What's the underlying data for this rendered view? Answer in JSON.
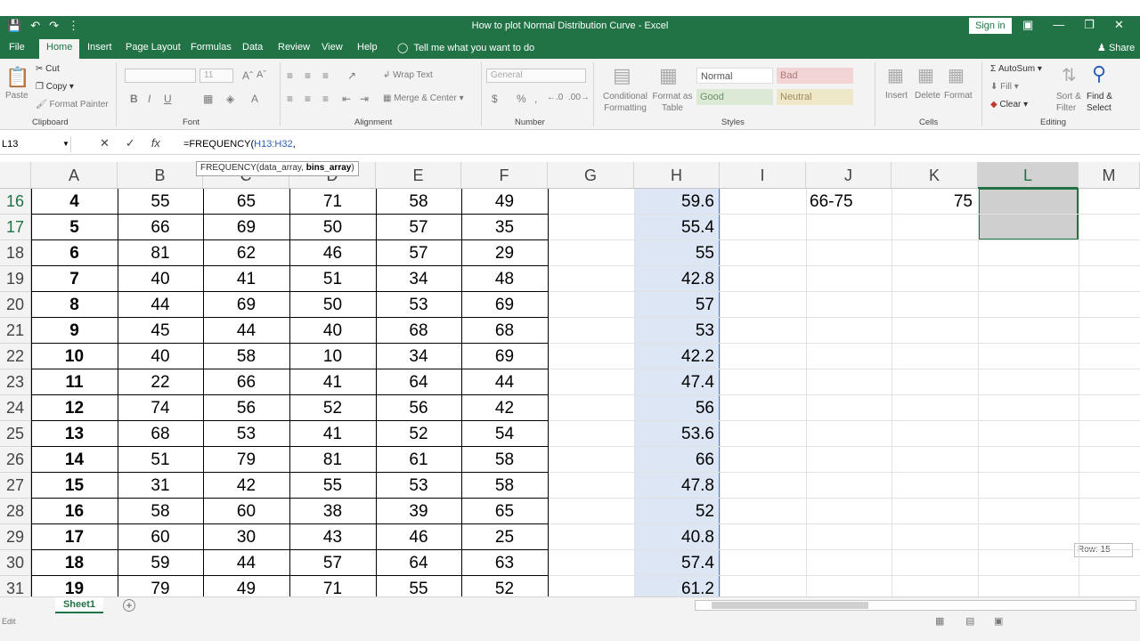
{
  "window": {
    "title": "How to plot Normal Distribution Curve  -  Excel",
    "signin": "Sign in",
    "share": "Share"
  },
  "tabs": [
    "File",
    "Home",
    "Insert",
    "Page Layout",
    "Formulas",
    "Data",
    "Review",
    "View",
    "Help"
  ],
  "tellme": "Tell me what you want to do",
  "ribbon": {
    "clipboard": {
      "paste": "Paste",
      "cut": "Cut",
      "copy": "Copy",
      "format_painter": "Format Painter",
      "label": "Clipboard"
    },
    "font": {
      "size": "11",
      "label": "Font"
    },
    "alignment": {
      "wrap": "Wrap Text",
      "merge": "Merge & Center",
      "label": "Alignment"
    },
    "number": {
      "format": "General",
      "label": "Number"
    },
    "styles": {
      "conditional": "Conditional Formatting",
      "format_as": "Format as Table",
      "normal": "Normal",
      "bad": "Bad",
      "good": "Good",
      "neutral": "Neutral",
      "label": "Styles"
    },
    "cells": {
      "insert": "Insert",
      "delete": "Delete",
      "format": "Format",
      "label": "Cells"
    },
    "editing": {
      "autosum": "AutoSum",
      "fill": "Fill",
      "clear": "Clear",
      "sort": "Sort & Filter",
      "find": "Find & Select",
      "label": "Editing"
    }
  },
  "formula_bar": {
    "namebox": "L13",
    "formula_prefix": "=FREQUENCY(",
    "formula_ref": "H13:H32",
    "formula_suffix": ",",
    "tooltip_prefix": "FREQUENCY(data_array, ",
    "tooltip_bold": "bins_array",
    "tooltip_suffix": ")"
  },
  "columns": [
    "A",
    "B",
    "C",
    "D",
    "E",
    "F",
    "G",
    "H",
    "I",
    "J",
    "K",
    "L",
    "M"
  ],
  "rows": [
    {
      "n": "16",
      "a": "4",
      "b": "55",
      "c": "65",
      "d": "71",
      "e": "58",
      "f": "49",
      "h": "59.6",
      "j": "66-75",
      "k": "75"
    },
    {
      "n": "17",
      "a": "5",
      "b": "66",
      "c": "69",
      "d": "50",
      "e": "57",
      "f": "35",
      "h": "55.4"
    },
    {
      "n": "18",
      "a": "6",
      "b": "81",
      "c": "62",
      "d": "46",
      "e": "57",
      "f": "29",
      "h": "55"
    },
    {
      "n": "19",
      "a": "7",
      "b": "40",
      "c": "41",
      "d": "51",
      "e": "34",
      "f": "48",
      "h": "42.8"
    },
    {
      "n": "20",
      "a": "8",
      "b": "44",
      "c": "69",
      "d": "50",
      "e": "53",
      "f": "69",
      "h": "57"
    },
    {
      "n": "21",
      "a": "9",
      "b": "45",
      "c": "44",
      "d": "40",
      "e": "68",
      "f": "68",
      "h": "53"
    },
    {
      "n": "22",
      "a": "10",
      "b": "40",
      "c": "58",
      "d": "10",
      "e": "34",
      "f": "69",
      "h": "42.2"
    },
    {
      "n": "23",
      "a": "11",
      "b": "22",
      "c": "66",
      "d": "41",
      "e": "64",
      "f": "44",
      "h": "47.4"
    },
    {
      "n": "24",
      "a": "12",
      "b": "74",
      "c": "56",
      "d": "52",
      "e": "56",
      "f": "42",
      "h": "56"
    },
    {
      "n": "25",
      "a": "13",
      "b": "68",
      "c": "53",
      "d": "41",
      "e": "52",
      "f": "54",
      "h": "53.6"
    },
    {
      "n": "26",
      "a": "14",
      "b": "51",
      "c": "79",
      "d": "81",
      "e": "61",
      "f": "58",
      "h": "66"
    },
    {
      "n": "27",
      "a": "15",
      "b": "31",
      "c": "42",
      "d": "55",
      "e": "53",
      "f": "58",
      "h": "47.8"
    },
    {
      "n": "28",
      "a": "16",
      "b": "58",
      "c": "60",
      "d": "38",
      "e": "39",
      "f": "65",
      "h": "52"
    },
    {
      "n": "29",
      "a": "17",
      "b": "60",
      "c": "30",
      "d": "43",
      "e": "46",
      "f": "25",
      "h": "40.8"
    },
    {
      "n": "30",
      "a": "18",
      "b": "59",
      "c": "44",
      "d": "57",
      "e": "64",
      "f": "63",
      "h": "57.4"
    },
    {
      "n": "31",
      "a": "19",
      "b": "79",
      "c": "49",
      "d": "71",
      "e": "55",
      "f": "52",
      "h": "61.2"
    }
  ],
  "row_tip": "Row: 15",
  "sheet": {
    "name": "Sheet1",
    "add": "+"
  },
  "status": {
    "mode": "Edit"
  }
}
